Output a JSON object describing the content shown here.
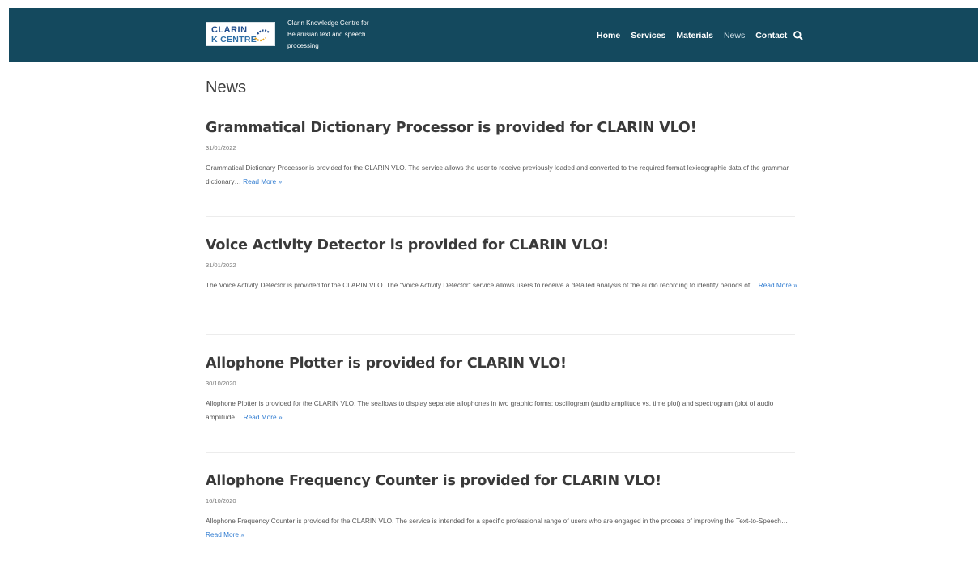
{
  "header": {
    "logo": {
      "line1": "CLARIN",
      "line2": "K CENTRE"
    },
    "tagline": "Clarin Knowledge Centre for Belarusian text and speech processing",
    "nav": [
      {
        "label": "Home",
        "active": false
      },
      {
        "label": "Services",
        "active": false
      },
      {
        "label": "Materials",
        "active": false
      },
      {
        "label": "News",
        "active": true
      },
      {
        "label": "Contact",
        "active": false
      }
    ],
    "search_icon": "search-icon",
    "bg_color": "#14495e"
  },
  "page": {
    "title": "News"
  },
  "posts": [
    {
      "title": "Grammatical Dictionary Processor is provided for CLARIN VLO!",
      "date": "31/01/2022",
      "excerpt": "Grammatical Dictionary Processor is provided for the CLARIN VLO. The service allows the user to receive previously loaded and converted to the required format lexicographic data of the grammar dictionary…",
      "read_more": "Read More »"
    },
    {
      "title": "Voice Activity Detector is provided for CLARIN VLO!",
      "date": "31/01/2022",
      "excerpt": "The Voice Activity Detector is provided for the CLARIN VLO.  The \"Voice Activity Detector\" service allows users to receive a detailed analysis of the audio recording to identify periods of…",
      "read_more": "Read More »"
    },
    {
      "title": "Allophone Plotter is provided for CLARIN VLO!",
      "date": "30/10/2020",
      "excerpt": "Allophone Plotter is provided for the CLARIN VLO. The seallows to display separate allophones in two graphic forms: oscillogram (audio amplitude vs. time plot) and spectrogram (plot of audio amplitude…",
      "read_more": "Read More »"
    },
    {
      "title": "Allophone Frequency Counter is provided for CLARIN VLO!",
      "date": "16/10/2020",
      "excerpt": "Allophone Frequency Counter is provided for the CLARIN VLO. The service is intended for a specific professional range of users who are engaged in the process of improving the Text-to-Speech…",
      "read_more": "Read More »"
    }
  ],
  "colors": {
    "link": "#2f7bd0",
    "title": "#3a3a3a"
  }
}
